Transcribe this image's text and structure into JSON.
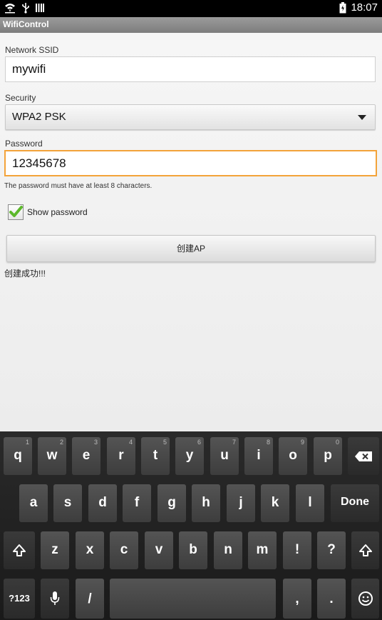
{
  "status_bar": {
    "time": "18:07",
    "icons": [
      "wifi-icon",
      "usb-icon",
      "barcode-icon",
      "battery-icon"
    ]
  },
  "app": {
    "title": "WifiControl"
  },
  "form": {
    "ssid_label": "Network SSID",
    "ssid_value": "mywifi",
    "security_label": "Security",
    "security_value": "WPA2 PSK",
    "password_label": "Password",
    "password_value": "12345678",
    "password_hint": "The password must have at least 8 characters.",
    "show_password_label": "Show password",
    "show_password_checked": true,
    "create_button": "创建AP",
    "result_text": "创建成功!!!"
  },
  "keyboard": {
    "row1": [
      {
        "ch": "q",
        "num": "1"
      },
      {
        "ch": "w",
        "num": "2"
      },
      {
        "ch": "e",
        "num": "3"
      },
      {
        "ch": "r",
        "num": "4"
      },
      {
        "ch": "t",
        "num": "5"
      },
      {
        "ch": "y",
        "num": "6"
      },
      {
        "ch": "u",
        "num": "7"
      },
      {
        "ch": "i",
        "num": "8"
      },
      {
        "ch": "o",
        "num": "9"
      },
      {
        "ch": "p",
        "num": "0"
      }
    ],
    "row2": [
      "a",
      "s",
      "d",
      "f",
      "g",
      "h",
      "j",
      "k",
      "l"
    ],
    "row3": [
      "z",
      "x",
      "c",
      "v",
      "b",
      "n",
      "m",
      "!",
      "?"
    ],
    "done": "Done",
    "symbols": "?123",
    "slash": "/",
    "comma": ",",
    "period": "."
  }
}
